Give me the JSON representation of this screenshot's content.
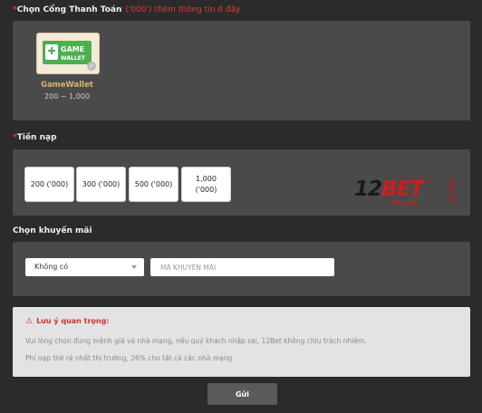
{
  "gateway": {
    "title": "Chọn Cổng Thanh Toán",
    "hint": "('000') thêm thông tin ở đây",
    "card": {
      "name": "GameWallet",
      "range": "200 ~ 1,000",
      "logo_line1": "GAME",
      "logo_line2": "WALLET"
    }
  },
  "topup": {
    "title": "Tiền nạp",
    "amounts": [
      "200 ('000)",
      "300 ('000)",
      "500 ('000)",
      "1,000\n('000)"
    ],
    "brand": {
      "name_dark": "12",
      "name_red": "BET",
      "sub": "ONLINE",
      "cn": "壹贰博"
    }
  },
  "promo": {
    "title": "Chọn khuyến mãi",
    "select_value": "Không có",
    "code_placeholder": "MÃ KHUYẾN MÃI"
  },
  "notice": {
    "title": "Lưu ý quan trọng:",
    "line1": "Vui lòng chọn đúng mệnh giá và nhà mạng, nếu quý khách nhập sai, 12Bet không chịu trách nhiệm.",
    "line2": "Phí nạp thẻ rẻ nhất thị trường, 26% cho tất cả các nhà mạng."
  },
  "submit_label": "Gửi",
  "colors": {
    "accent_red": "#e53935",
    "gold": "#d8b56a",
    "panel": "#4a4a4a",
    "background": "#2b2b2b"
  }
}
